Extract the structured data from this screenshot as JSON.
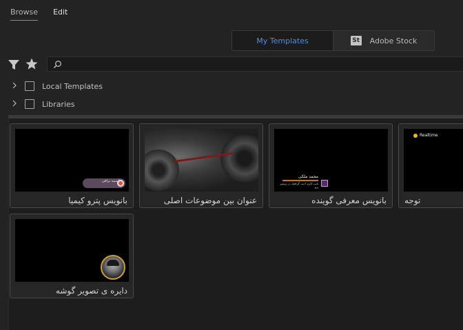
{
  "tabs": {
    "browse": "Browse",
    "edit": "Edit"
  },
  "source_toggle": {
    "my_templates": "My Templates",
    "stock_badge": "St",
    "adobe_stock": "Adobe Stock"
  },
  "search": {
    "placeholder": ""
  },
  "tree": [
    {
      "label": "Local Templates"
    },
    {
      "label": "Libraries"
    }
  ],
  "templates": [
    {
      "title": "بانویس پترو کیمیا",
      "thumb_text": "یاسمه تراقی"
    },
    {
      "title": "عنوان بین موضوعات اصلی"
    },
    {
      "title": "بانویس معرفی گوینده",
      "thumb_name": "محمد ملکی",
      "thumb_sub": "ثابت کاری ادیت گرافیک در پریمیر پرو"
    },
    {
      "title": "توجه",
      "thumb_text": "Realtime"
    },
    {
      "title": "دایره ی تصویر گوشه"
    }
  ],
  "colors": {
    "accent": "#4e8fe0",
    "background": "#232323"
  }
}
